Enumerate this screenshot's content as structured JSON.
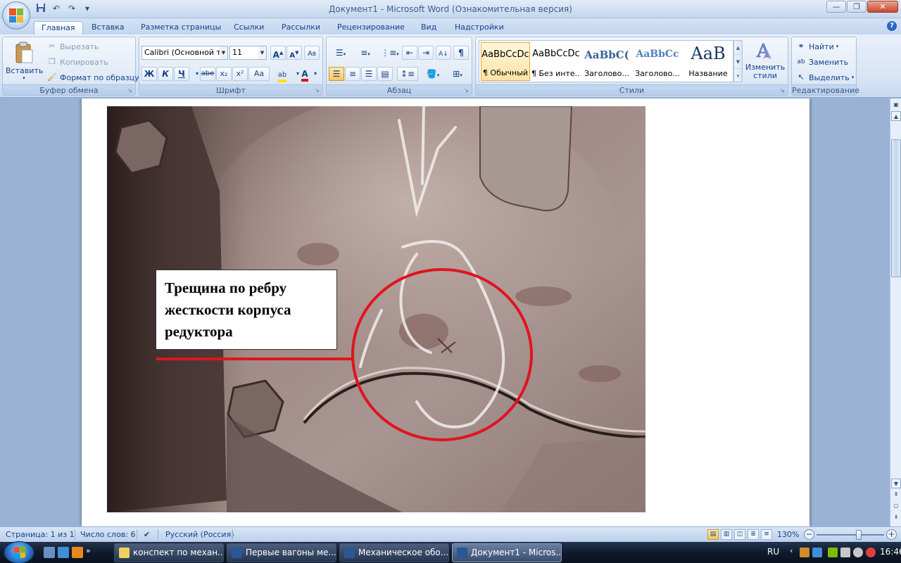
{
  "window": {
    "title": "Документ1 - Microsoft Word (Ознакомительная версия)",
    "controls": [
      "minimize",
      "restore",
      "close"
    ]
  },
  "quick_access": {
    "icons": [
      "save-icon",
      "undo-icon",
      "redo-icon",
      "customize-icon"
    ]
  },
  "ribbon_tabs": [
    "Главная",
    "Вставка",
    "Разметка страницы",
    "Ссылки",
    "Рассылки",
    "Рецензирование",
    "Вид",
    "Надстройки"
  ],
  "active_tab": "Главная",
  "clipboard": {
    "paste_label": "Вставить",
    "cut_label": "Вырезать",
    "copy_label": "Копировать",
    "format_painter_label": "Формат по образцу",
    "group_label": "Буфер обмена"
  },
  "font": {
    "font_name": "Calibri (Основной те",
    "font_size": "11",
    "group_label": "Шрифт",
    "buttons": [
      "Ж",
      "К",
      "Ч",
      "abe",
      "x₂",
      "x²",
      "Aa"
    ]
  },
  "paragraph": {
    "group_label": "Абзац",
    "pilcrow": "¶"
  },
  "styles": {
    "group_label": "Стили",
    "items": [
      {
        "preview": "AaBbCcDc",
        "name": "¶ Обычный",
        "selected": true
      },
      {
        "preview": "AaBbCcDc",
        "name": "¶ Без инте...",
        "selected": false
      },
      {
        "preview": "AaBbC(",
        "name": "Заголово...",
        "selected": false
      },
      {
        "preview": "AaBbCc",
        "name": "Заголово...",
        "selected": false
      },
      {
        "preview": "AaB",
        "name": "Название",
        "selected": false
      }
    ],
    "change_styles_label": "Изменить стили"
  },
  "editing": {
    "group_label": "Редактирование",
    "find_label": "Найти",
    "replace_label": "Заменить",
    "select_label": "Выделить"
  },
  "document": {
    "callout_text": "Трещина по ребру жесткости корпуса редуктора",
    "annotation_color": "#e0141e"
  },
  "statusbar": {
    "page": "Страница: 1 из 1",
    "words": "Число слов: 6",
    "language": "Русский (Россия)",
    "zoom": "130%",
    "zoom_fraction": 0.62
  },
  "taskbar": {
    "tasks": [
      {
        "label": "конспект по механ...",
        "active": false
      },
      {
        "label": "Первые вагоны ме...",
        "active": false
      },
      {
        "label": "Механическое обо...",
        "active": false
      },
      {
        "label": "Документ1 - Micros...",
        "active": true
      }
    ],
    "language": "RU",
    "clock": "16:46"
  }
}
